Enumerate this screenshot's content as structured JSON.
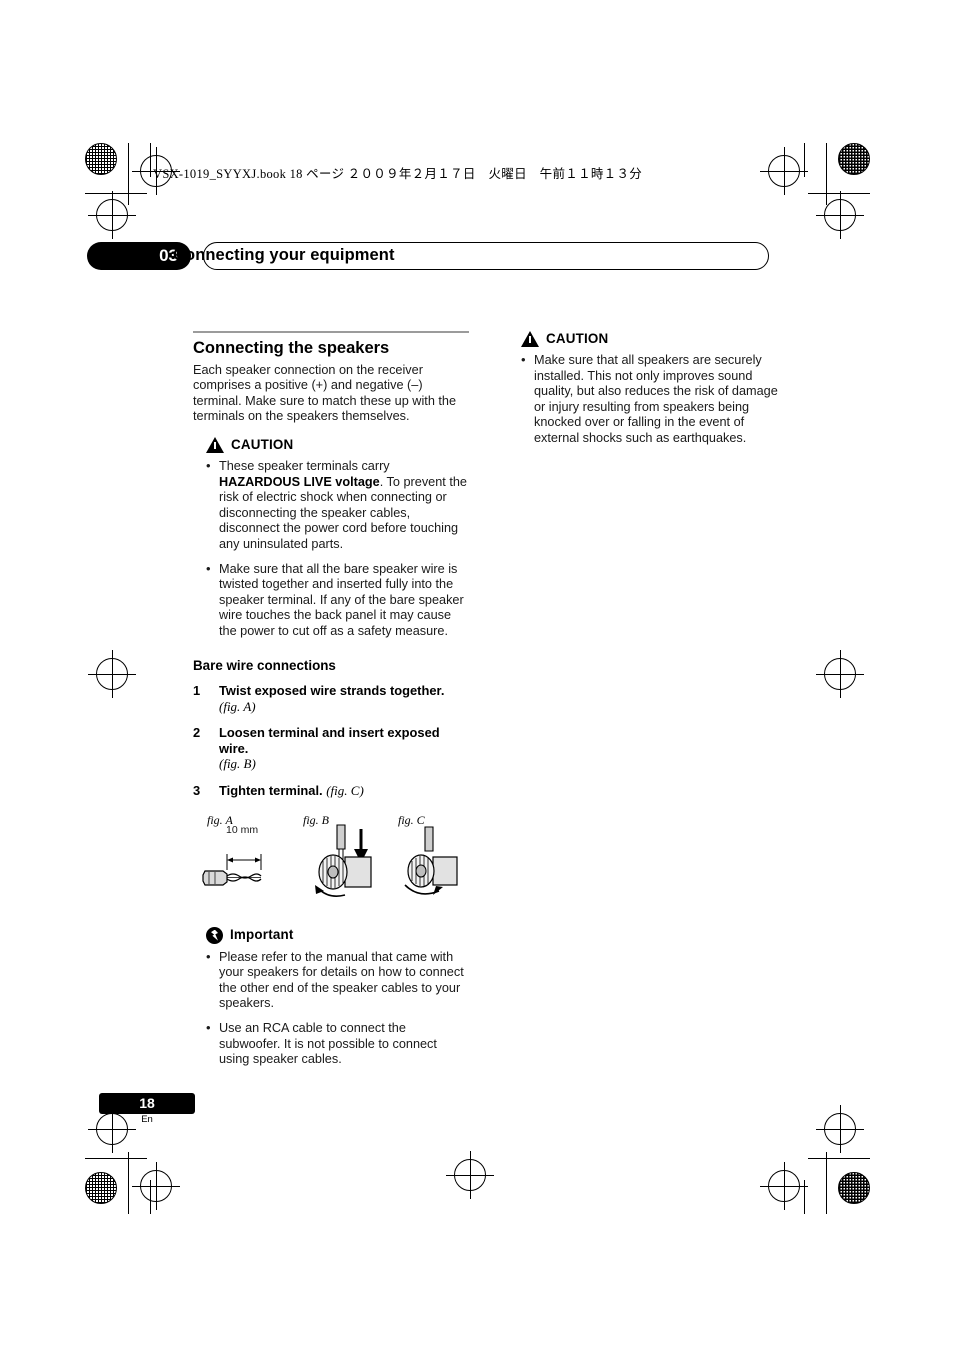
{
  "header": {
    "book_line": "VSX-1019_SYYXJ.book   18 ページ   ２００９年２月１７日　火曜日　午前１１時１３分"
  },
  "chapter": {
    "number": "03",
    "title": "Connecting your equipment"
  },
  "left_column": {
    "section_title": "Connecting the speakers",
    "intro": "Each speaker connection on the receiver comprises a positive (+) and negative (–) terminal. Make sure to match these up with the terminals on the speakers themselves.",
    "caution_label": "CAUTION",
    "caution_items": [
      {
        "lead": "These speaker terminals carry ",
        "bold": "HAZARDOUS LIVE voltage",
        "tail": ". To prevent the risk of electric shock when connecting or disconnecting the speaker cables, disconnect the power cord before touching any uninsulated parts."
      },
      {
        "lead": "Make sure that all the bare speaker wire is twisted together and inserted fully into the speaker terminal. If any of the bare speaker wire touches the back panel it may cause the power to cut off as a safety measure.",
        "bold": "",
        "tail": ""
      }
    ],
    "subsection_title": "Bare wire connections",
    "steps": [
      {
        "num": "1",
        "text": "Twist exposed wire strands together.",
        "figref": "(fig. A)"
      },
      {
        "num": "2",
        "text": "Loosen terminal and insert exposed wire.",
        "figref": "(fig. B)"
      },
      {
        "num": "3",
        "text": "Tighten terminal.",
        "figref": "(fig. C)"
      }
    ],
    "figures": [
      {
        "label": "fig. A",
        "dimension": "10 mm"
      },
      {
        "label": "fig. B",
        "dimension": ""
      },
      {
        "label": "fig. C",
        "dimension": ""
      }
    ],
    "important_label": "Important",
    "important_items": [
      "Please refer to the manual that came with your speakers for details on how to connect the other end of the speaker cables to your speakers.",
      "Use an RCA cable to connect the subwoofer. It is not possible to connect using speaker cables."
    ]
  },
  "right_column": {
    "caution_label": "CAUTION",
    "caution_items": [
      "Make sure that all speakers are securely installed. This not only improves sound quality, but also reduces the risk of damage or injury resulting from speakers being knocked over or falling in the event of external shocks such as earthquakes."
    ]
  },
  "footer": {
    "page_number": "18",
    "language": "En"
  }
}
